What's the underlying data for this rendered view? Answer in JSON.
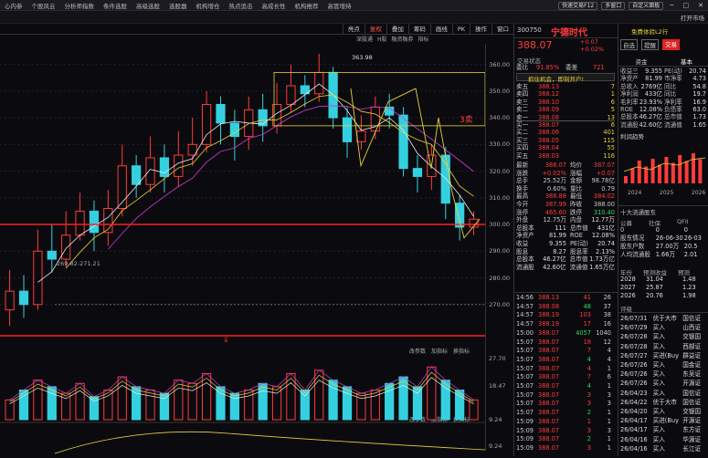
{
  "topbar": {
    "items": [
      "心内参",
      "个股风云",
      "分析师指数",
      "条件选股",
      "高级选股",
      "选股器",
      "机构增仓",
      "热点追击",
      "高成长性",
      "机构推荐",
      "高管增持"
    ],
    "fast_trade": "快速交易F12",
    "multi_window": "多窗口",
    "custom_panel": "自定义面板",
    "open": "打开市场"
  },
  "chart_toolbar": {
    "items": [
      "亮点",
      "复权",
      "叠加",
      "筹码",
      "画线",
      "PK",
      "操作",
      "窗口"
    ],
    "active": "复权"
  },
  "sub_toolbar": {
    "items": [
      "深股通",
      "H股",
      "融资融券",
      "指标"
    ]
  },
  "main": {
    "price_axis": [
      "360.00",
      "350.00",
      "340.00",
      "330.00",
      "320.00",
      "310.00",
      "300.00",
      "290.00",
      "280.00",
      "270.00"
    ],
    "high_label": "363.98",
    "range_label": "269.82-271.21",
    "sell_signal": "3卖",
    "arrow": "⇓"
  },
  "vol": {
    "tools": [
      "改参数",
      "加指标",
      "换指标"
    ],
    "axis": [
      "27.70",
      "18.47",
      "9.24"
    ],
    "axis2": [
      "9.24"
    ]
  },
  "stock": {
    "code": "300750",
    "name": "宁德时代",
    "price": "388.07",
    "change": "+0.07",
    "change_pct": "+0.02%",
    "tab1": "自选",
    "tab2": "提醒",
    "tab3": "交易",
    "status": "交易状态",
    "wb": "委比",
    "wb_val": "91.85%",
    "wc": "委差",
    "wc_val": "721",
    "promo": "抓住机会，即刻开户!"
  },
  "order_book": [
    [
      "卖五",
      "388.13",
      "7"
    ],
    [
      "卖四",
      "388.12",
      "1"
    ],
    [
      "卖三",
      "388.10",
      "6"
    ],
    [
      "卖二",
      "388.09",
      "5"
    ],
    [
      "卖一",
      "388.08",
      "13"
    ],
    [
      "买一",
      "388.07",
      "6"
    ],
    [
      "买二",
      "388.06",
      "401"
    ],
    [
      "买三",
      "388.05",
      "115"
    ],
    [
      "买四",
      "388.04",
      "55"
    ],
    [
      "买五",
      "388.03",
      "116"
    ]
  ],
  "stats": [
    [
      "最新",
      "388.07",
      "均价",
      "387.07"
    ],
    [
      "涨跌",
      "+0.02%",
      "涨幅",
      "+0.07"
    ],
    [
      "总手",
      "25.52万",
      "金额",
      "98.78亿"
    ],
    [
      "换手",
      "0.60%",
      "量比",
      "0.79"
    ],
    [
      "最高",
      "388.88",
      "最低",
      "384.02"
    ],
    [
      "今开",
      "387.99",
      "昨收",
      "388.00"
    ],
    [
      "涨停",
      "465.60",
      "跌停",
      "310.40"
    ],
    [
      "外盘",
      "12.75万",
      "内盘",
      "12.77万"
    ],
    [
      "总股本",
      "111",
      "总市值",
      "431亿"
    ],
    [
      "净资产",
      "81.99",
      "ROE",
      "12.08%"
    ],
    [
      "收益",
      "9.355",
      "PE(动)",
      "20.74"
    ],
    [
      "股息",
      "8.27",
      "股息率",
      "2.13%"
    ],
    [
      "总股本",
      "46.27亿",
      "总市值",
      "1.73万亿"
    ],
    [
      "流通股",
      "42.60亿",
      "流通值",
      "1.65万亿"
    ]
  ],
  "ticks": [
    [
      "14:56",
      "388.13",
      "41",
      "26"
    ],
    [
      "14:57",
      "388.08",
      "48",
      "37"
    ],
    [
      "14:57",
      "388.19",
      "103",
      "38"
    ],
    [
      "14:57",
      "388.19",
      "17",
      "16"
    ],
    [
      "15:00",
      "388.07",
      "4057",
      "1040"
    ],
    [
      "15:07",
      "388.07",
      "18",
      "12"
    ],
    [
      "15:07",
      "388.07",
      "7",
      "4"
    ],
    [
      "15:07",
      "388.07",
      "4",
      "4"
    ],
    [
      "15:07",
      "388.07",
      "4",
      "1"
    ],
    [
      "15:07",
      "388.07",
      "7",
      "6"
    ],
    [
      "15:07",
      "388.07",
      "4",
      "1"
    ],
    [
      "15:07",
      "388.07",
      "3",
      "3"
    ],
    [
      "15:07",
      "388.07",
      "3",
      "3"
    ],
    [
      "15:07",
      "388.07",
      "2",
      "1"
    ],
    [
      "15:09",
      "388.07",
      "1",
      "1"
    ],
    [
      "15:09",
      "388.07",
      "3",
      "3"
    ],
    [
      "15:09",
      "388.07",
      "2",
      "1"
    ],
    [
      "15:09",
      "388.07",
      "3",
      "1"
    ]
  ],
  "right": {
    "free_l2": "免费体验L2行",
    "tabs": [
      "资金",
      "基本"
    ],
    "fund": [
      [
        "收益三",
        "9.355",
        "PE(动)",
        "20.74"
      ],
      [
        "净资产",
        "81.99",
        "市净率",
        "4.73"
      ],
      [
        "总收入",
        "2769亿",
        "同比",
        "54.8"
      ],
      [
        "净利润",
        "433亿",
        "同比",
        "19.7"
      ],
      [
        "毛利率",
        "23.93%",
        "净利率",
        "16.9"
      ],
      [
        "ROE",
        "12.08%",
        "负债率",
        "63.0"
      ],
      [
        "总股本",
        "46.27亿",
        "总市值",
        "1.73"
      ],
      [
        "流通股",
        "42.60亿",
        "流通值",
        "1.65"
      ]
    ],
    "trend_label": "利润趋势",
    "years": [
      "2024",
      "2025",
      "2026"
    ],
    "holders_label": "十大流通股东",
    "hold_tabs": [
      "公募",
      "社保",
      "QFII"
    ],
    "holders": [
      [
        "0",
        "0",
        "0"
      ],
      [
        "股东情况",
        "26-06-30",
        "26-03"
      ],
      [
        "股东户数",
        "27.00万",
        "20.5"
      ],
      [
        "人均流通股",
        "1.66万",
        "2.01"
      ]
    ],
    "eps_label": "年份",
    "eps_cols": [
      "预测收益",
      "预测"
    ],
    "eps": [
      [
        "2028",
        "31.04",
        "1.48"
      ],
      [
        "2027",
        "25.87",
        "1.23"
      ],
      [
        "2026",
        "20.76",
        "1.98"
      ]
    ],
    "eval_tab": "评级",
    "ratings": [
      [
        "26/07/31",
        "优于大市",
        "国信证"
      ],
      [
        "26/07/29",
        "买入",
        "山西证"
      ],
      [
        "26/07/28",
        "买入",
        "交银国"
      ],
      [
        "26/07/28",
        "买入",
        "西部证"
      ],
      [
        "26/07/27",
        "买进(Buy",
        "群益证"
      ],
      [
        "26/07/26",
        "买入",
        "国金证"
      ],
      [
        "26/07/26",
        "买入",
        "东吴证"
      ],
      [
        "26/07/26",
        "买入",
        "开源证"
      ],
      [
        "26/04/23",
        "买入",
        "国信证"
      ],
      [
        "26/04/22",
        "优于大市",
        "国信证"
      ],
      [
        "26/04/20",
        "买入",
        "交银国"
      ],
      [
        "26/04/17",
        "买进(Buy",
        "开源证"
      ],
      [
        "26/04/17",
        "买入",
        "东方证"
      ],
      [
        "26/04/16",
        "买入",
        "华源证"
      ],
      [
        "26/04/16",
        "买入",
        "长江证"
      ]
    ]
  },
  "chart_data": {
    "type": "candlestick",
    "ylim": [
      260,
      365
    ],
    "series": [
      {
        "o": 268,
        "c": 275,
        "h": 283,
        "l": 262
      },
      {
        "o": 275,
        "c": 270,
        "h": 281,
        "l": 265
      },
      {
        "o": 270,
        "c": 290,
        "h": 298,
        "l": 268
      },
      {
        "o": 290,
        "c": 287,
        "h": 300,
        "l": 282
      },
      {
        "o": 287,
        "c": 296,
        "h": 305,
        "l": 284
      },
      {
        "o": 296,
        "c": 305,
        "h": 312,
        "l": 294
      },
      {
        "o": 305,
        "c": 297,
        "h": 309,
        "l": 290
      },
      {
        "o": 297,
        "c": 306,
        "h": 313,
        "l": 292
      },
      {
        "o": 306,
        "c": 322,
        "h": 330,
        "l": 303
      },
      {
        "o": 322,
        "c": 315,
        "h": 326,
        "l": 310
      },
      {
        "o": 315,
        "c": 325,
        "h": 333,
        "l": 312
      },
      {
        "o": 325,
        "c": 318,
        "h": 330,
        "l": 312
      },
      {
        "o": 318,
        "c": 326,
        "h": 335,
        "l": 314
      },
      {
        "o": 326,
        "c": 330,
        "h": 340,
        "l": 322
      },
      {
        "o": 330,
        "c": 345,
        "h": 350,
        "l": 327
      },
      {
        "o": 345,
        "c": 338,
        "h": 348,
        "l": 330
      },
      {
        "o": 338,
        "c": 333,
        "h": 343,
        "l": 324
      },
      {
        "o": 333,
        "c": 343,
        "h": 348,
        "l": 328
      },
      {
        "o": 343,
        "c": 337,
        "h": 349,
        "l": 331
      },
      {
        "o": 337,
        "c": 345,
        "h": 353,
        "l": 334
      },
      {
        "o": 345,
        "c": 352,
        "h": 360,
        "l": 342
      },
      {
        "o": 352,
        "c": 349,
        "h": 356,
        "l": 344
      },
      {
        "o": 349,
        "c": 357,
        "h": 364,
        "l": 346
      },
      {
        "o": 357,
        "c": 340,
        "h": 359,
        "l": 336
      },
      {
        "o": 340,
        "c": 331,
        "h": 344,
        "l": 325
      },
      {
        "o": 331,
        "c": 335,
        "h": 341,
        "l": 328
      },
      {
        "o": 335,
        "c": 344,
        "h": 348,
        "l": 332
      },
      {
        "o": 344,
        "c": 341,
        "h": 349,
        "l": 336
      },
      {
        "o": 341,
        "c": 321,
        "h": 344,
        "l": 318
      },
      {
        "o": 321,
        "c": 318,
        "h": 326,
        "l": 312
      },
      {
        "o": 318,
        "c": 326,
        "h": 330,
        "l": 313
      },
      {
        "o": 326,
        "c": 308,
        "h": 329,
        "l": 302
      },
      {
        "o": 308,
        "c": 299,
        "h": 311,
        "l": 294
      },
      {
        "o": 299,
        "c": 302,
        "h": 305,
        "l": 296
      }
    ],
    "volumes": [
      6,
      9,
      12,
      10,
      8,
      11,
      7,
      9,
      13,
      10,
      9,
      8,
      12,
      11,
      14,
      10,
      8,
      9,
      11,
      10,
      14,
      9,
      15,
      12,
      10,
      8,
      9,
      11,
      13,
      10,
      16,
      12,
      9,
      6
    ]
  }
}
